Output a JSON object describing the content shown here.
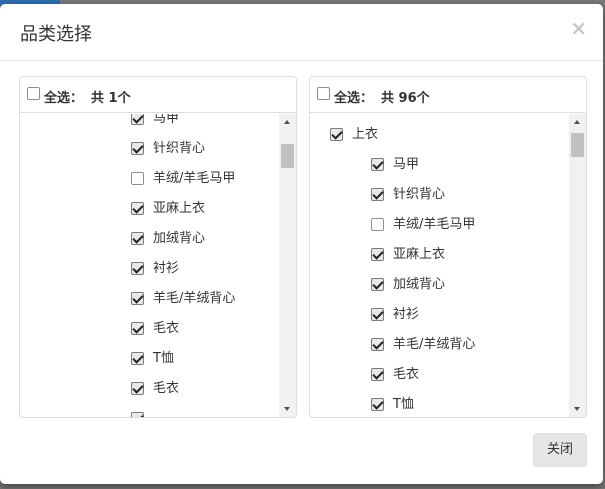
{
  "modal": {
    "title": "品类选择",
    "close_icon": "×",
    "close_button": "关闭"
  },
  "left_panel": {
    "select_all_label": "全选：",
    "count_label": "共 1个",
    "items": [
      {
        "label": "马甲",
        "checked": true
      },
      {
        "label": "针织背心",
        "checked": true
      },
      {
        "label": "羊绒/羊毛马甲",
        "checked": false
      },
      {
        "label": "亚麻上衣",
        "checked": true
      },
      {
        "label": "加绒背心",
        "checked": true
      },
      {
        "label": "衬衫",
        "checked": true
      },
      {
        "label": "羊毛/羊绒背心",
        "checked": true
      },
      {
        "label": "毛衣",
        "checked": true
      },
      {
        "label": "T恤",
        "checked": true
      },
      {
        "label": "毛衣",
        "checked": true
      },
      {
        "label": "",
        "checked": true
      }
    ]
  },
  "right_panel": {
    "select_all_label": "全选：",
    "count_label": "共 96个",
    "parent": {
      "label": "上衣",
      "checked": true
    },
    "items": [
      {
        "label": "马甲",
        "checked": true
      },
      {
        "label": "针织背心",
        "checked": true
      },
      {
        "label": "羊绒/羊毛马甲",
        "checked": false
      },
      {
        "label": "亚麻上衣",
        "checked": true
      },
      {
        "label": "加绒背心",
        "checked": true
      },
      {
        "label": "衬衫",
        "checked": true
      },
      {
        "label": "羊毛/羊绒背心",
        "checked": true
      },
      {
        "label": "毛衣",
        "checked": true
      },
      {
        "label": "T恤",
        "checked": true
      }
    ]
  }
}
